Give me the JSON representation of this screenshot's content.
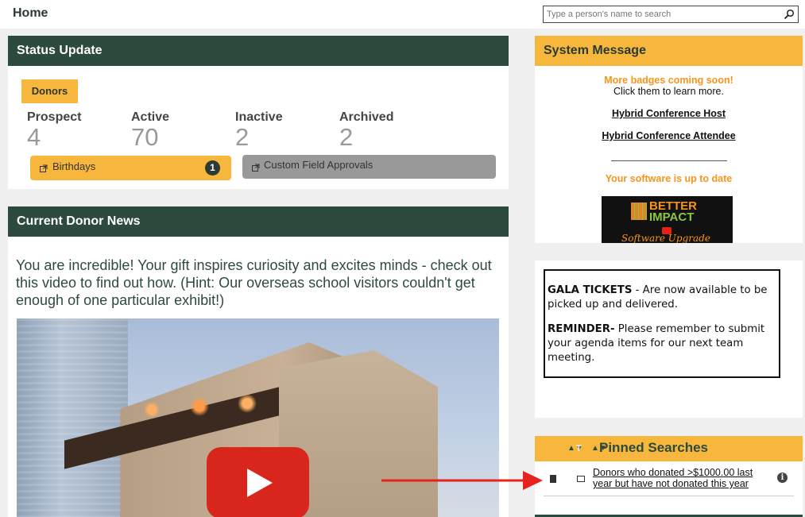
{
  "header": {
    "title": "Home",
    "search_placeholder": "Type a person's name to search"
  },
  "status_update": {
    "title": "Status Update",
    "tab_label": "Donors",
    "stats": [
      {
        "label": "Prospect",
        "value": "4"
      },
      {
        "label": "Active",
        "value": "70"
      },
      {
        "label": "Inactive",
        "value": "2"
      },
      {
        "label": "Archived",
        "value": "2"
      }
    ],
    "birthdays_label": "Birthdays",
    "birthdays_count": "1",
    "custom_field_label": "Custom Field Approvals"
  },
  "donor_news": {
    "title": "Current Donor News",
    "text": "You are incredible!  Your gift inspires curiosity and excites minds - check out this video to find out how.  (Hint: Our overseas school visitors couldn't get enough of one particular exhibit!)"
  },
  "system_message": {
    "title": "System Message",
    "badges_notice": "More badges coming soon!",
    "click_text": "Click them to learn more.",
    "link_host": "Hybrid Conference Host",
    "link_attendee": "Hybrid Conference Attendee",
    "uptodate": "Your software is up to date",
    "logo_line1": "BETTER",
    "logo_line2": "IMPACT",
    "logo_script": "Software Upgrade"
  },
  "gala": {
    "tickets_bold": "GALA TICKETS",
    "tickets_text": " - Are now available to be picked up and delivered.",
    "reminder_bold": "REMINDER-",
    "reminder_text": " Please remember to submit your agenda items for our next team meeting."
  },
  "pinned": {
    "title": "Pinned Searches",
    "sort_t": "T",
    "rows": [
      {
        "label": "Donors who donated >$1000.00 last year but have not donated this year"
      }
    ]
  },
  "colors": {
    "dark_green": "#2d4a3f",
    "yellow": "#f6b73c",
    "orange": "#f7941d",
    "arrow_red": "#e8231d"
  }
}
